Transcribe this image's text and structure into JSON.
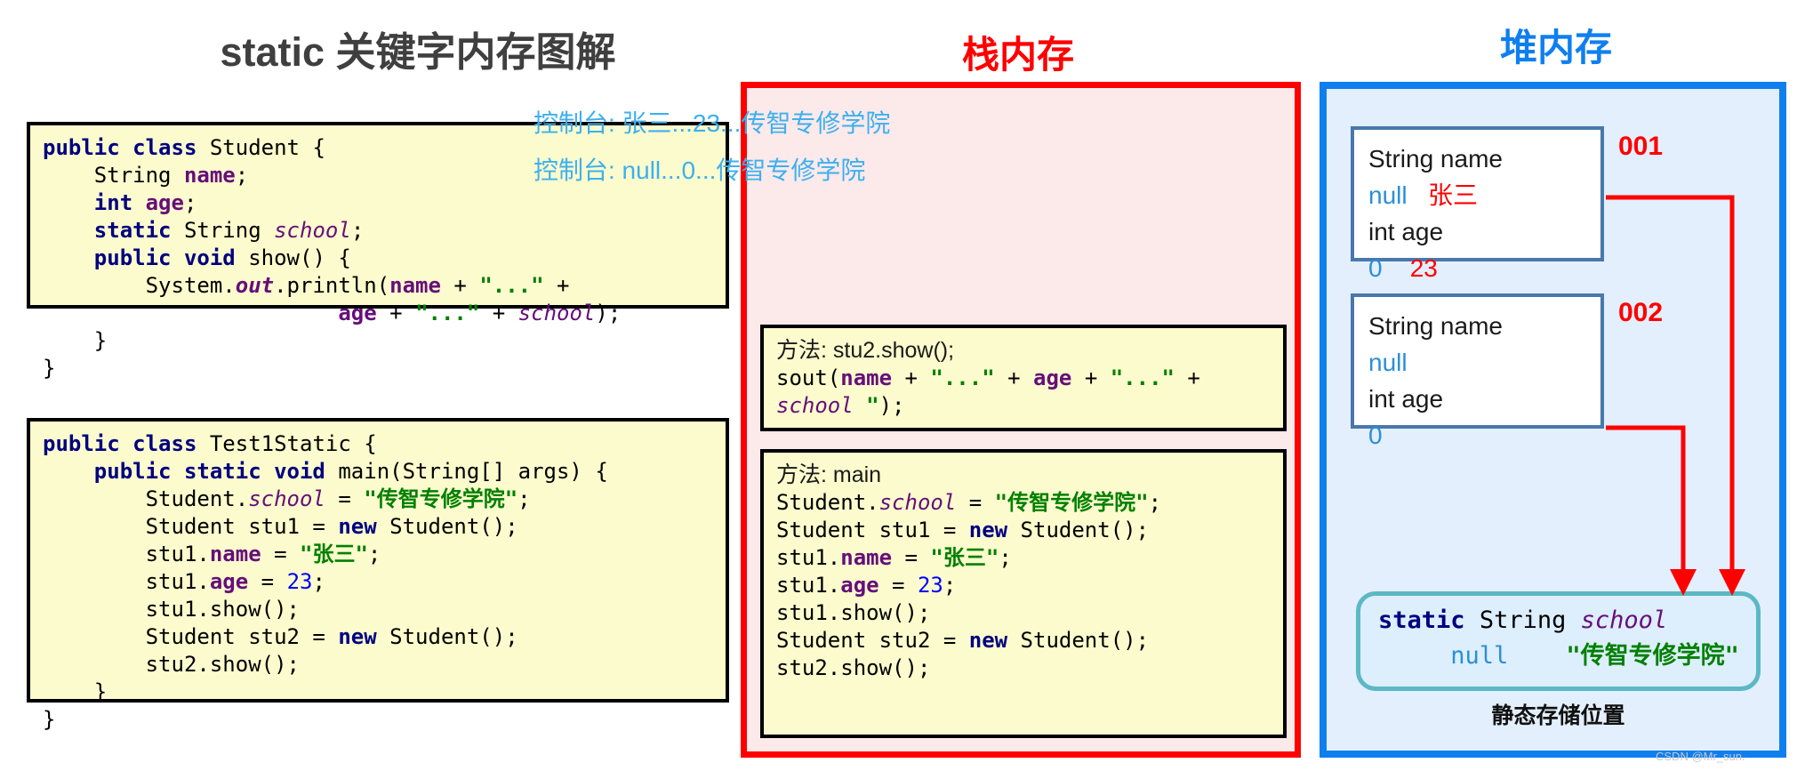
{
  "titles": {
    "main": "static 关键字内存图解",
    "stack": "栈内存",
    "heap": "堆内存"
  },
  "console": {
    "line1": "控制台: 张三...23...传智专修学院",
    "line2": "控制台: null...0...传智专修学院"
  },
  "code_student": {
    "lines": [
      "public class Student {",
      "    String name;",
      "    int age;",
      "    static String school;",
      "    public void show() {",
      "        System.out.println(name + \"...\" +",
      "                       age + \"...\" + school);",
      "    }",
      "}"
    ]
  },
  "code_test": {
    "lines": [
      "public class Test1Static {",
      "    public static void main(String[] args) {",
      "        Student.school = \"传智专修学院\";",
      "        Student stu1 = new Student();",
      "        stu1.name = \"张三\";",
      "        stu1.age = 23;",
      "        stu1.show();",
      "        Student stu2 = new Student();",
      "        stu2.show();",
      "    }",
      "}"
    ]
  },
  "stack": {
    "frame_show": {
      "title": "方法: stu2.show();",
      "lines": [
        "sout(name + \"...\" + age + \"...\" +",
        "school \");"
      ]
    },
    "frame_main": {
      "title": "方法: main",
      "lines": [
        "Student.school = \"传智专修学院\";",
        "Student stu1 = new Student();",
        "stu1.name = \"张三\";",
        "stu1.age = 23;",
        "stu1.show();",
        "Student stu2 = new Student();",
        "stu2.show();"
      ]
    }
  },
  "heap": {
    "object1": {
      "address": "001",
      "field_name_decl": "String name",
      "field_name_default": "null",
      "field_name_value": "张三",
      "field_age_decl": "int age",
      "field_age_default": "0",
      "field_age_value": "23"
    },
    "object2": {
      "address": "002",
      "field_name_decl": "String name",
      "field_name_default": "null",
      "field_name_value": "",
      "field_age_decl": "int age",
      "field_age_default": "0",
      "field_age_value": ""
    },
    "static_area": {
      "decl_static": "static",
      "decl_type": "String",
      "decl_name": "school",
      "default_value": "null",
      "assigned_value": "\"传智专修学院\"",
      "caption": "静态存储位置"
    }
  },
  "watermark": "CSDN @Mr_sun.",
  "colors": {
    "stack_accent": "#ff0000",
    "heap_accent": "#0f7ff0",
    "console_text": "#3db0ef",
    "code_bg": "#fbfbcd",
    "keyword": "#000080",
    "string": "#008000",
    "field": "#660e7a",
    "number": "#0000ff",
    "null_value": "#2a8fd8",
    "new_value": "#ff0000",
    "static_border": "#5cb8c4"
  }
}
